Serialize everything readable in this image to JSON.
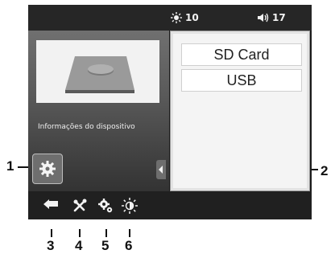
{
  "status_bar": {
    "brightness_value": "10",
    "volume_value": "17",
    "brightness_icon": "brightness-icon",
    "volume_icon": "speaker-icon"
  },
  "device_panel": {
    "info_label": "Informações do dispositivo"
  },
  "storage": {
    "options": [
      "SD Card",
      "USB"
    ]
  },
  "callouts": {
    "n1": "1",
    "n2": "2",
    "n3": "3",
    "n4": "4",
    "n5": "5",
    "n6": "6"
  },
  "bottom_bar": {
    "icons": [
      "back-arrow-icon",
      "tools-icon",
      "settings-gears-icon",
      "brightness-icon"
    ]
  }
}
